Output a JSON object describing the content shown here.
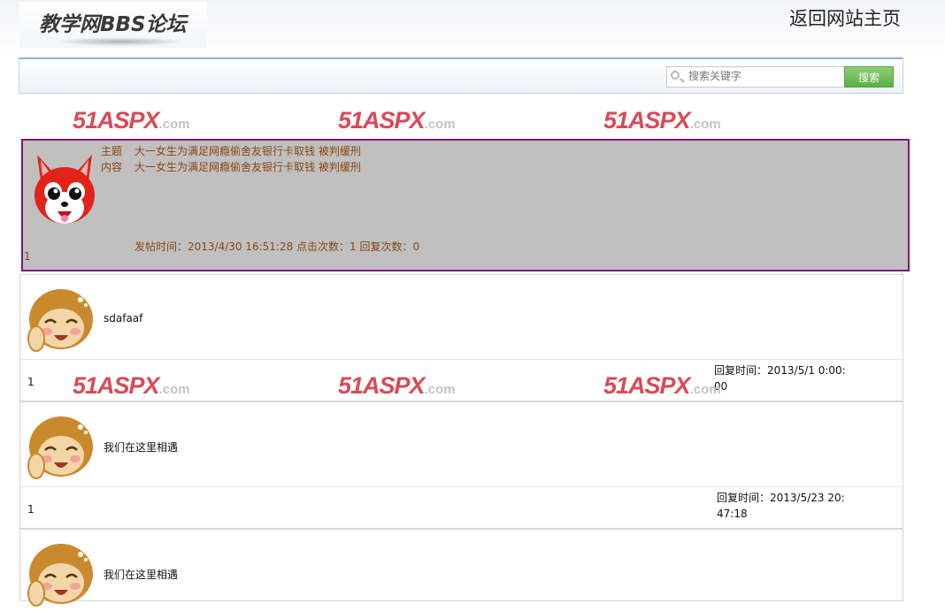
{
  "header": {
    "logo_text": "教学网BBS论坛",
    "home_link": "返回网站主页"
  },
  "search": {
    "placeholder": "搜索关键字",
    "button_label": "搜索"
  },
  "banner": {
    "main": "51ASPX",
    "suffix": ".com"
  },
  "topic": {
    "subject_label": "主题",
    "subject": "大一女生为满足网瘾偷舍友银行卡取钱 被判缓刑",
    "content_label": "内容",
    "content": "大一女生为满足网瘾偷舍友银行卡取钱 被判缓刑",
    "meta": "发帖时间：2013/4/30 16:51:28 点击次数：1 回复次数：0",
    "number": "1"
  },
  "replies": [
    {
      "content": "sdafaaf",
      "number": "1",
      "reply_time": "回复时间：2013/5/1 0:00:00"
    },
    {
      "content": "我们在这里相遇",
      "number": "1",
      "reply_time": "回复时间：2013/5/23 20:47:18"
    },
    {
      "content": "我们在这里相遇",
      "number": "",
      "reply_time": ""
    }
  ],
  "colors": {
    "topic_bg": "#c0c0c0",
    "topic_border": "#7b1a7b",
    "topic_text": "#8b4513",
    "search_button": "#5cae45",
    "banner_red": "#d94a57"
  },
  "icons": {
    "topic_avatar": "red-fox-avatar-icon",
    "reply_avatar": "monkey-avatar-icon",
    "search": "search-icon"
  }
}
